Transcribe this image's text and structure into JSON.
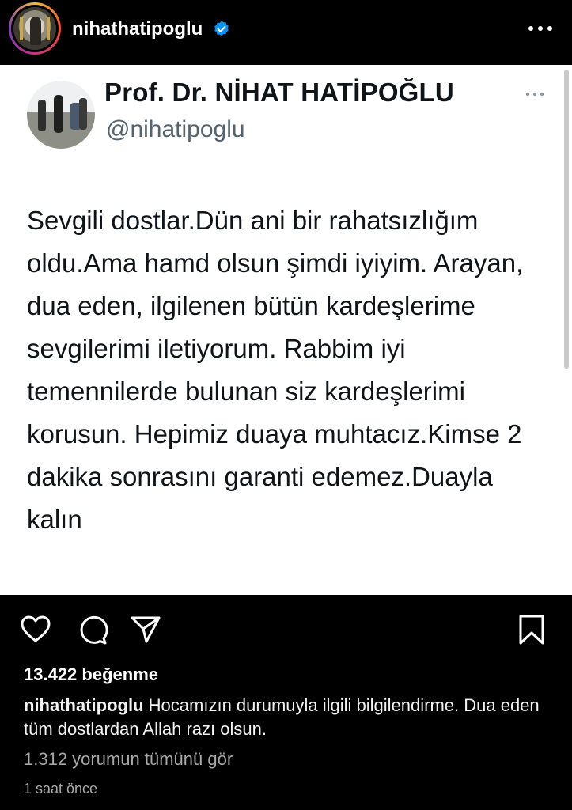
{
  "post_header": {
    "username": "nihathatipoglu",
    "verified_icon": "verified-badge-icon",
    "more_icon": "more-horizontal-icon"
  },
  "tweet": {
    "display_name": "Prof. Dr. NİHAT HATİPOĞLU",
    "handle": "@nihatipoglu",
    "text": "Sevgili dostlar.Dün ani bir rahatsızlığım oldu.Ama hamd olsun şimdi iyiyim. Arayan, dua eden, ilgilenen bütün kardeşlerime sevgilerimi iletiyorum. Rabbim iyi temennilerde bulunan siz kardeşlerimi korusun. Hepimiz duaya muhtacız.Kimse 2 dakika sonrasını garanti edemez.Duayla kalın",
    "more_icon": "more-horizontal-icon"
  },
  "actions": {
    "like_icon": "heart-icon",
    "comment_icon": "comment-icon",
    "share_icon": "send-icon",
    "save_icon": "bookmark-icon"
  },
  "likes": "13.422 beğenme",
  "caption": {
    "username": "nihathatipoglu",
    "text": "Hocamızın durumuyla ilgili bilgilendirme. Dua eden tüm dostlardan Allah razı olsun."
  },
  "comments_link": "1.312 yorumun tümünü gör",
  "timestamp": "1 saat önce",
  "colors": {
    "background": "#000000",
    "card": "#ffffff",
    "verified": "#0095f6",
    "secondary_text": "#a8a8a8",
    "handle": "#536471"
  }
}
